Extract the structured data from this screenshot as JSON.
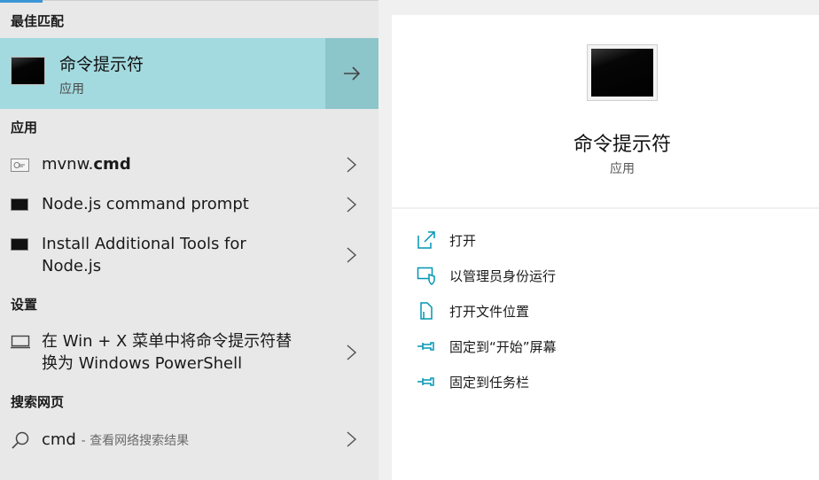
{
  "left": {
    "sections": {
      "best_match": "最佳匹配",
      "apps": "应用",
      "settings": "设置",
      "web": "搜索网页"
    },
    "best_match": {
      "title": "命令提示符",
      "subtitle": "应用"
    },
    "apps": [
      {
        "name_prefix": "mvnw.",
        "name_bold": "cmd",
        "icon": "file-icon"
      },
      {
        "name": "Node.js command prompt",
        "icon": "console-icon"
      },
      {
        "line1": "Install Additional Tools for",
        "line2": "Node.js",
        "icon": "console-icon"
      }
    ],
    "settings": [
      {
        "line1": "在 Win + X 菜单中将命令提示符替",
        "line2": "换为 Windows PowerShell",
        "icon": "laptop-icon"
      }
    ],
    "web": [
      {
        "query": "cmd",
        "suffix": "- 查看网络搜索结果",
        "icon": "search-icon"
      }
    ]
  },
  "right": {
    "title": "命令提示符",
    "subtitle": "应用",
    "actions": [
      {
        "label": "打开",
        "icon": "open-icon"
      },
      {
        "label": "以管理员身份运行",
        "icon": "admin-shield-icon"
      },
      {
        "label": "打开文件位置",
        "icon": "file-location-icon"
      },
      {
        "label": "固定到“开始”屏幕",
        "icon": "pin-icon"
      },
      {
        "label": "固定到任务栏",
        "icon": "pin-icon"
      }
    ]
  },
  "colors": {
    "selected_bg": "#a3dadf",
    "selected_arrow_bg": "#8cc5ca",
    "accent": "#0096b4"
  }
}
